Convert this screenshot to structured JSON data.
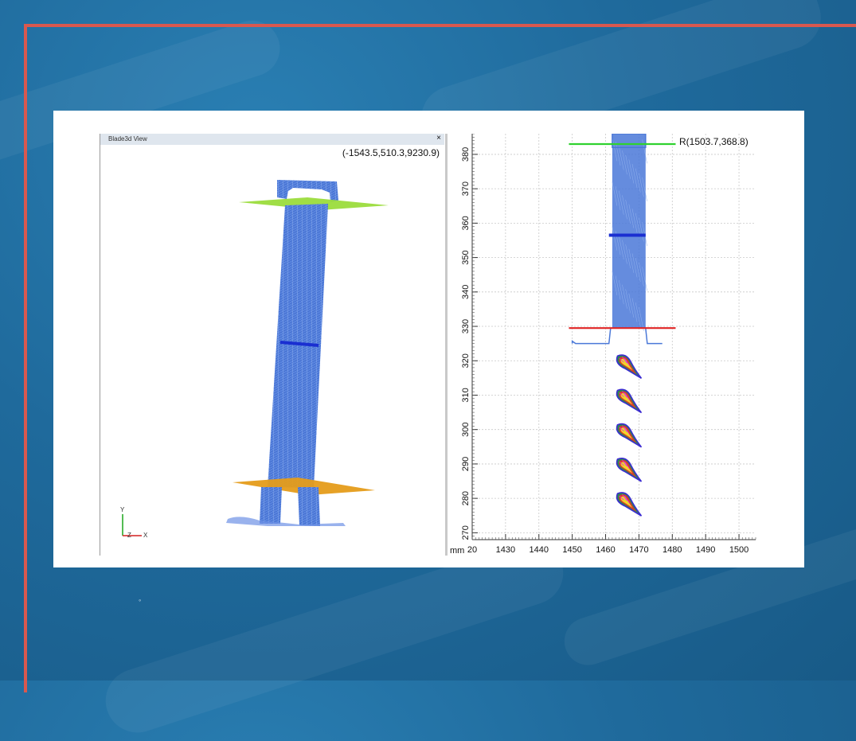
{
  "left_view": {
    "title": "Blade3d View",
    "close_glyph": "×",
    "coordinate_readout": "(-1543.5,510.3,9230.9)",
    "axis_labels": [
      "Y",
      "X",
      "Z"
    ]
  },
  "right_view": {
    "coordinate_readout": "R(1503.7,368.8)",
    "unit_label": "mm"
  },
  "colors": {
    "background": "#1f6a9c",
    "frame": "#d9584f",
    "blade_points": "#4a78d8",
    "top_plane": "#9bdc3c",
    "mid_section": "#1a2fd1",
    "bottom_plane": "#e59c1a",
    "green_line": "#2fd12f",
    "red_line": "#e02424",
    "grid": "#c8c8c8"
  },
  "chart_data": {
    "type": "scatter",
    "title": "",
    "xlabel": "mm",
    "ylabel": "",
    "xlim": [
      1420,
      1505
    ],
    "ylim": [
      268,
      386
    ],
    "x_ticks": [
      "20",
      "1430",
      "1440",
      "1450",
      "1460",
      "1470",
      "1480",
      "1490",
      "1500"
    ],
    "y_ticks": [
      "270",
      "280",
      "290",
      "300",
      "310",
      "320",
      "330",
      "340",
      "350",
      "360",
      "370",
      "380"
    ],
    "grid": true,
    "lines": [
      {
        "color": "green",
        "y": 383,
        "x_from": 1449,
        "x_to": 1481
      },
      {
        "color": "blue",
        "y": 356.5,
        "x_from": 1461,
        "x_to": 1472
      },
      {
        "color": "red",
        "y": 329.5,
        "x_from": 1449,
        "x_to": 1481
      }
    ],
    "blade_region": {
      "x_from": 1462,
      "x_to": 1472,
      "y_from": 329.5,
      "y_to": 386
    },
    "section_profiles_y": [
      320,
      310,
      300,
      290,
      280
    ]
  }
}
